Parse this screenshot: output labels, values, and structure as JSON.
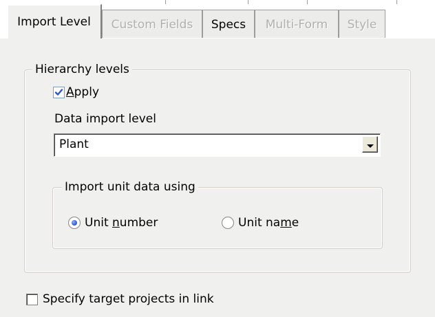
{
  "tabs": [
    {
      "label": "Import Level",
      "state": "selected"
    },
    {
      "label": "Custom Fields",
      "state": "disabled"
    },
    {
      "label": "Specs",
      "state": "normal"
    },
    {
      "label": "Multi-Form",
      "state": "disabled"
    },
    {
      "label": "Style",
      "state": "disabled"
    }
  ],
  "hierarchy": {
    "title": "Hierarchy levels",
    "apply": {
      "label_accel": "A",
      "label_rest": "pply",
      "checked": true
    },
    "import_level_label": "Data import level",
    "import_level_value": "Plant",
    "unit_group": {
      "title": "Import unit data using",
      "options": [
        {
          "label_pre": "Unit ",
          "label_accel": "n",
          "label_post": "umber",
          "selected": true
        },
        {
          "label_pre": "Unit na",
          "label_accel": "m",
          "label_post": "e",
          "selected": false
        }
      ]
    }
  },
  "target_projects": {
    "label": "Specify target projects in link",
    "checked": false
  },
  "colors": {
    "accent_check": "#2b55c9",
    "disabled_text": "#b0b0b0"
  }
}
